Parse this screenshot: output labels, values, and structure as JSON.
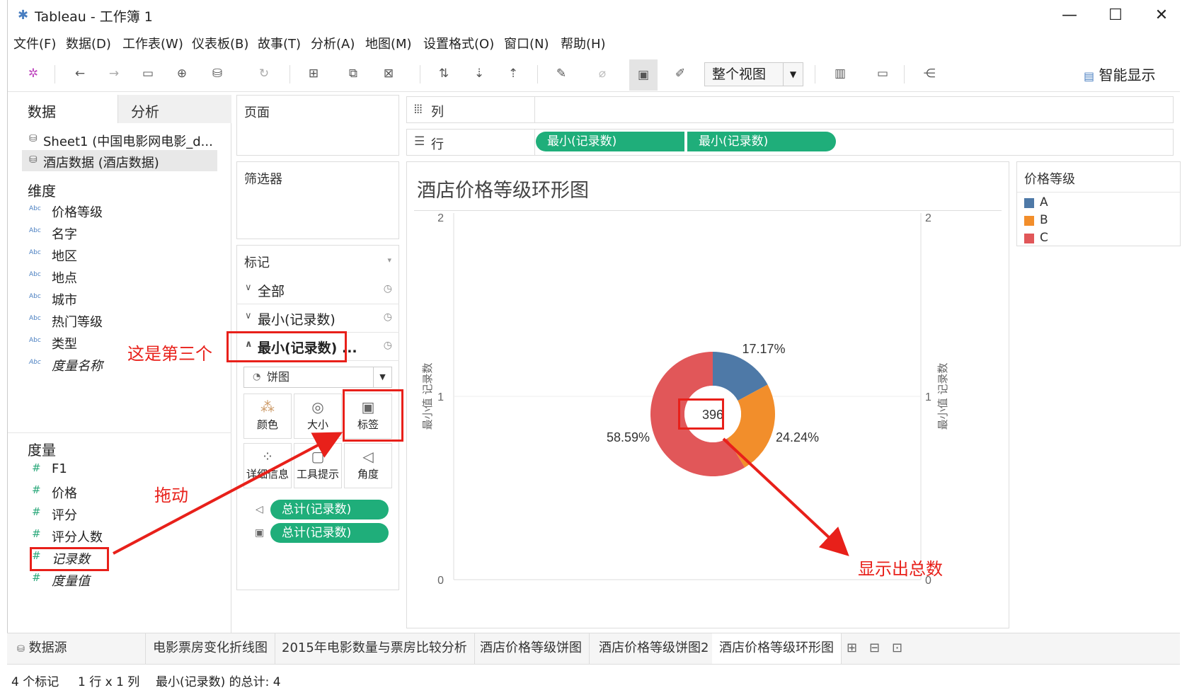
{
  "window": {
    "title": "Tableau - 工作簿 1",
    "minimize": "—",
    "maximize": "☐",
    "close": "✕"
  },
  "menu": [
    "文件(F)",
    "数据(D)",
    "工作表(W)",
    "仪表板(B)",
    "故事(T)",
    "分析(A)",
    "地图(M)",
    "设置格式(O)",
    "窗口(N)",
    "帮助(H)"
  ],
  "toolbar": {
    "view_select": "整个视图",
    "smart_show": "智能显示"
  },
  "left_panel": {
    "tab_data": "数据",
    "tab_analysis": "分析",
    "sources": [
      "Sheet1 (中国电影网电影_d...",
      "酒店数据 (酒店数据)"
    ],
    "dimensions_header": "维度",
    "dimensions": [
      "价格等级",
      "名字",
      "地区",
      "地点",
      "城市",
      "热门等级",
      "类型",
      "度量名称"
    ],
    "dimension_icon": "Abc",
    "measures_header": "度量",
    "measures": [
      "F1",
      "价格",
      "评分",
      "评分人数",
      "记录数",
      "度量值"
    ],
    "measure_icon": "#"
  },
  "cards": {
    "pages": "页面",
    "filters": "筛选器",
    "marks": "标记",
    "marks_all": "全部",
    "marks_1": "最小(记录数)",
    "marks_2": "最小(记录数) ...",
    "mark_type": "饼图",
    "buttons": [
      "颜色",
      "大小",
      "标签",
      "详细信息",
      "工具提示",
      "角度"
    ],
    "pill_angle": "总计(记录数)",
    "pill_label": "总计(记录数)"
  },
  "shelves": {
    "columns": "列",
    "rows": "行",
    "row_pills": [
      "最小(记录数)",
      "最小(记录数)"
    ]
  },
  "chart_data": {
    "type": "pie",
    "title": "酒店价格等级环形图",
    "center_label": "396",
    "categories": [
      "A",
      "B",
      "C"
    ],
    "values": [
      17.17,
      24.24,
      58.59
    ],
    "labels": [
      "17.17%",
      "24.24%",
      "58.59%"
    ],
    "colors": [
      "#4e79a7",
      "#f28e2b",
      "#e15759"
    ],
    "ylabel": "最小值 记录数",
    "yticks": [
      "2",
      "1",
      "0"
    ]
  },
  "legend": {
    "title": "价格等级",
    "items": [
      {
        "label": "A",
        "color": "#4e79a7"
      },
      {
        "label": "B",
        "color": "#f28e2b"
      },
      {
        "label": "C",
        "color": "#e15759"
      }
    ]
  },
  "bottom_tabs": [
    "数据源",
    "电影票房变化折线图",
    "2015年电影数量与票房比较分析",
    "酒店价格等级饼图",
    "酒店价格等级饼图2",
    "酒店价格等级环形图"
  ],
  "status": {
    "marks": "4 个标记",
    "grid": "1 行 x 1 列",
    "sum": "最小(记录数) 的总计: 4"
  },
  "annotations": {
    "third": "这是第三个",
    "drag": "拖动",
    "show_total": "显示出总数"
  }
}
